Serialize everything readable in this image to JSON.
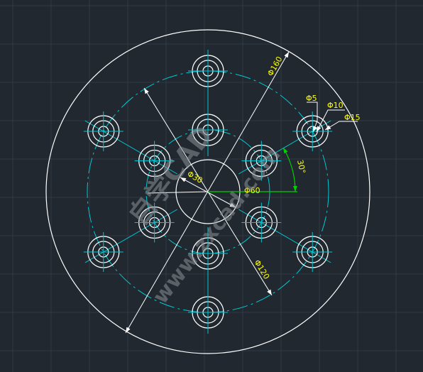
{
  "colors": {
    "background": "#212830",
    "grid": "#2f3945",
    "geometry": "#ffffff",
    "centerline": "#00c8d2",
    "dimension_text": "#ffff00",
    "angle_dim": "#00d000",
    "watermark": "#8a8f96"
  },
  "dimensions": {
    "outer_diameter": "Φ160",
    "pattern_120_diameter": "Φ120",
    "bore_diameter": "Φ60",
    "pattern_30_diameter": "Φ30",
    "hole_inner": "Φ5",
    "hole_middle": "Φ10",
    "hole_outer": "Φ15",
    "angle": "30°"
  },
  "watermark": {
    "line1": "自学CAD",
    "line2": "www.zxcad.com"
  }
}
